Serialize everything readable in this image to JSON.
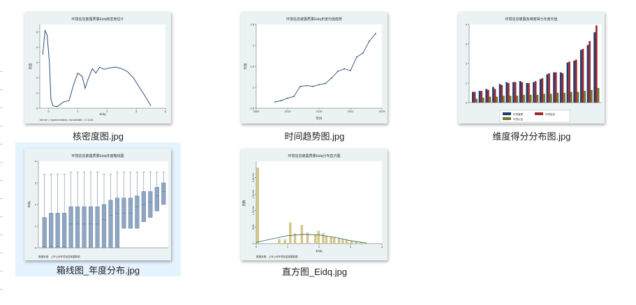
{
  "files": [
    {
      "id": "kde",
      "label": "核密度图.jpg",
      "selected": false,
      "title": "环境信息披露质量Eidq核密度估计",
      "xlabel": "Eidq",
      "ylabel": "密度",
      "caption": "kernel = epanechnikov, bandwidth = 0.1115",
      "ylim": [
        0,
        5.5
      ],
      "xlim": [
        -0.3,
        4
      ],
      "yticks": [
        0,
        1,
        2,
        3,
        4,
        5
      ],
      "xticks": [
        0,
        1,
        2,
        3,
        4
      ]
    },
    {
      "id": "trend",
      "label": "时间趋势图.jpg",
      "selected": false,
      "title": "环境信息披露质量Eidq年度均值趋势",
      "xlabel": "年份",
      "ylabel": "均值",
      "ylim": [
        0.5,
        2.5
      ],
      "xlim": [
        2005,
        2025
      ],
      "yticks": [
        0.5,
        1,
        1.5,
        2,
        2.5
      ],
      "xticks": [
        2005,
        2010,
        2015,
        2020,
        2025
      ]
    },
    {
      "id": "dims",
      "label": "维度得分分布图.jpg",
      "selected": false,
      "title": "环境信息披露各维度得分年度均值",
      "legend": [
        "环境管理",
        "环境信息",
        "环境认证"
      ],
      "colors": [
        "#1f3a6b",
        "#9e2a2f",
        "#6b7a2a"
      ],
      "ylim": [
        0,
        4
      ],
      "yticks": [
        0,
        1,
        2,
        3,
        4
      ]
    },
    {
      "id": "box",
      "label": "箱线图_年度分布.jpg",
      "selected": true,
      "title": "环境信息披露质量Eidq年度箱线图",
      "ylabel": "Eidq",
      "caption": "数据来源：上市公司环境信息披露数据",
      "ylim": [
        0,
        4
      ],
      "yticks": [
        0,
        1,
        2,
        3,
        4
      ]
    },
    {
      "id": "hist",
      "label": "直方图_Eidq.jpg",
      "selected": false,
      "title": "环境信息披露质量Eidq分布直方图",
      "xlabel": "Eidq",
      "ylabel": "频数",
      "caption": "数据来源：上市公司环境信息披露数据",
      "ylim": [
        0,
        25000
      ],
      "yticks": [
        "0",
        "5000",
        "1.0e+04",
        "1.5e+04",
        "2.0e+04"
      ],
      "xticks": [
        0,
        1,
        2,
        3,
        4
      ]
    }
  ]
}
